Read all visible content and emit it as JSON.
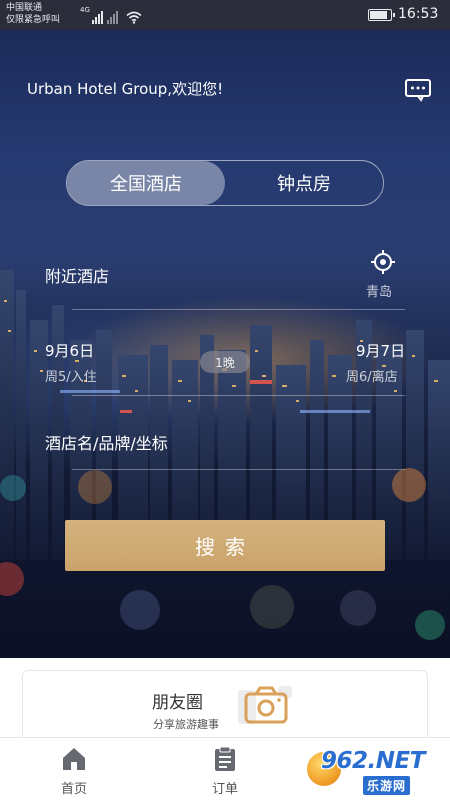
{
  "status_bar": {
    "carrier": "中国联通",
    "carrier_sub": "仅限紧急呼叫",
    "network": "4G",
    "time": "16:53",
    "battery_level": 0.85
  },
  "header": {
    "welcome": "Urban Hotel Group,欢迎您!",
    "message_icon": "chat-icon"
  },
  "segment": {
    "tabs": [
      "全国酒店",
      "钟点房"
    ],
    "active_index": 0
  },
  "form": {
    "location_label": "附近酒店",
    "locate_icon": "crosshair-icon",
    "city": "青岛",
    "checkin_date": "9月6日",
    "checkin_sub": "周5/入住",
    "nights": "1晚",
    "checkout_date": "9月7日",
    "checkout_sub": "周6/离店",
    "hotel_placeholder": "酒店名/品牌/坐标",
    "search_label": "搜索"
  },
  "card": {
    "title": "朋友圈",
    "subtitle": "分享旅游趣事",
    "icon": "camera-icon"
  },
  "tabbar": {
    "items": [
      {
        "label": "首页",
        "icon": "home-icon"
      },
      {
        "label": "订单",
        "icon": "clipboard-icon"
      }
    ]
  },
  "watermark": {
    "brand": "962.NET",
    "sub": "乐游网"
  },
  "colors": {
    "accent_gold": "#cfa872",
    "hero_dark": "#121a34",
    "camera_orange": "#d9a15a"
  }
}
